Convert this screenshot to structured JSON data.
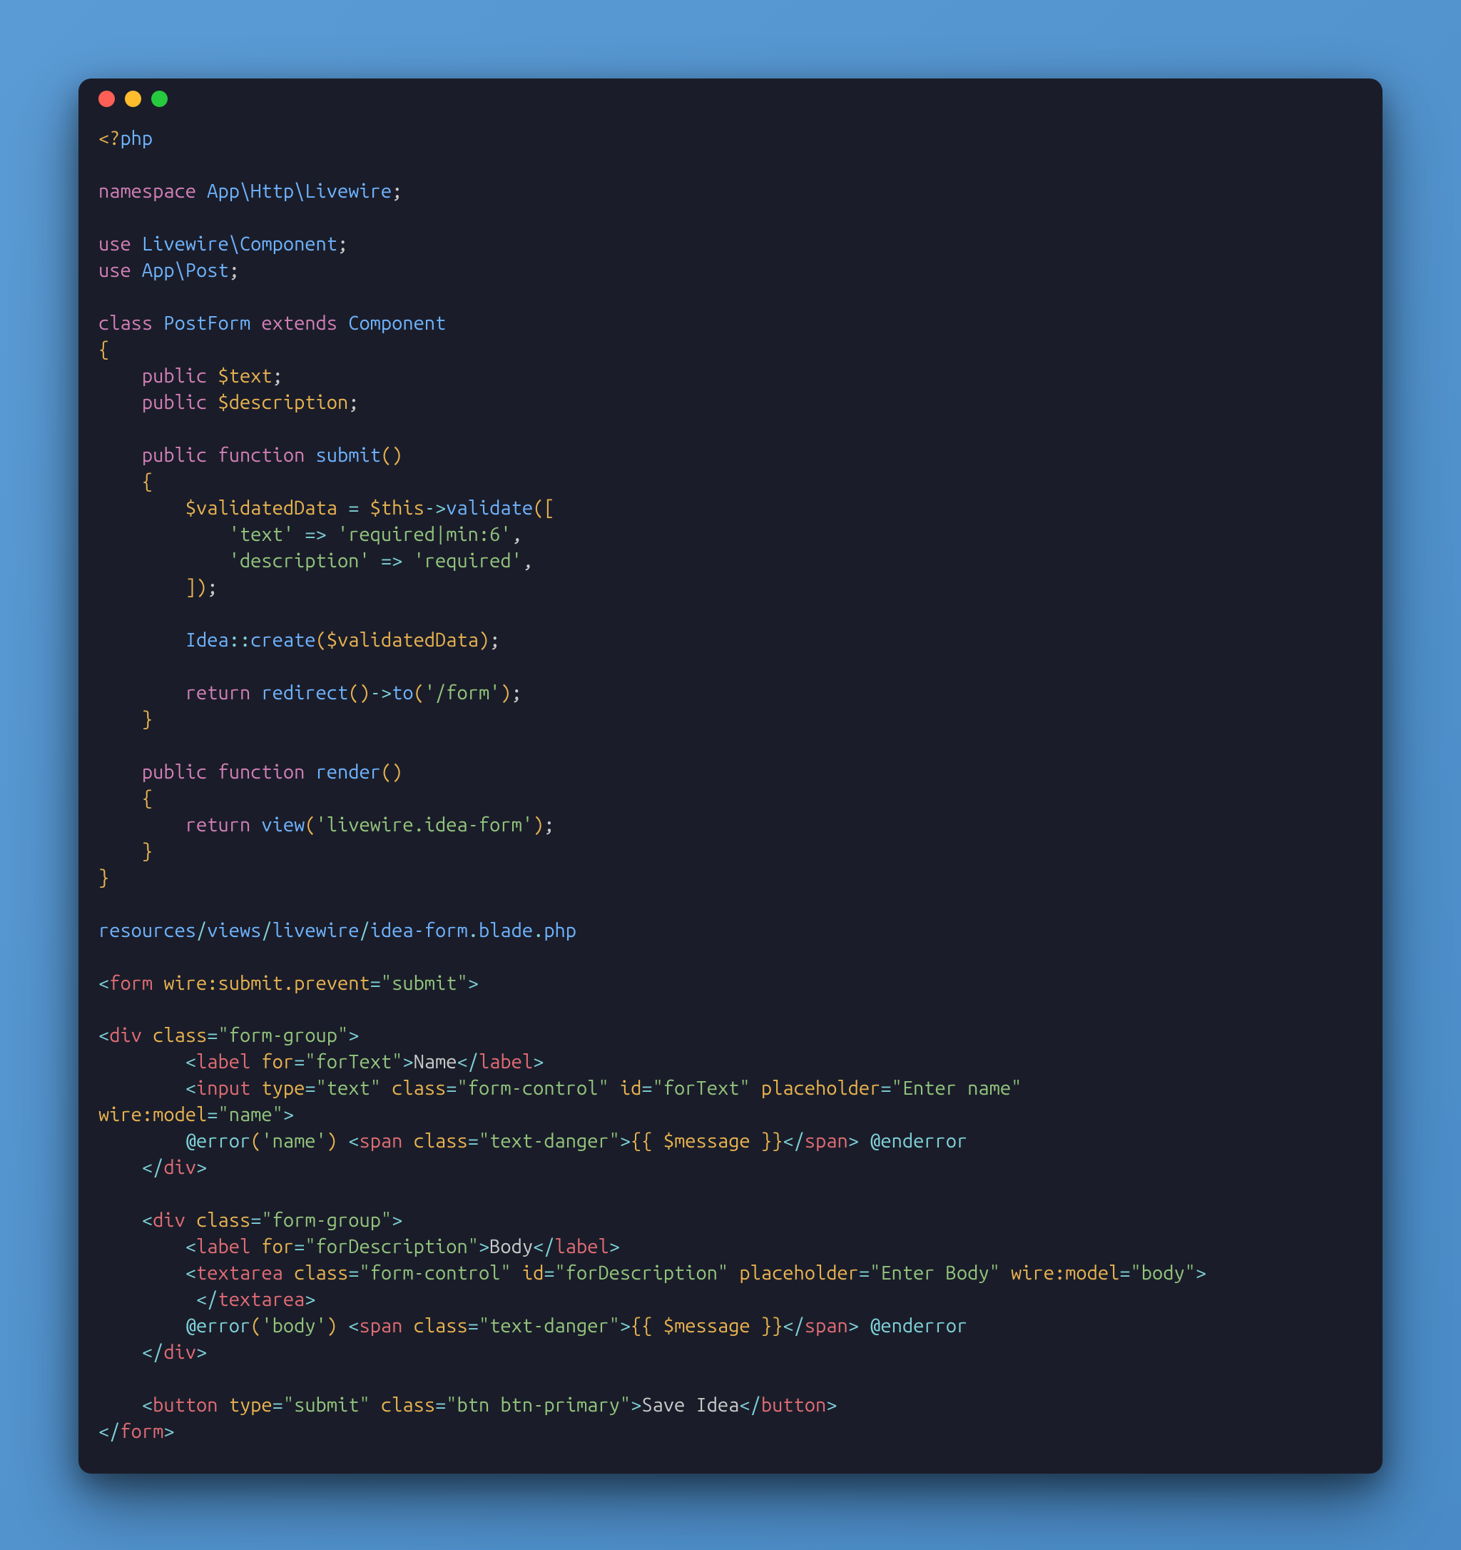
{
  "window": {
    "traffic_lights": [
      "close",
      "minimize",
      "zoom"
    ]
  },
  "code": {
    "php_open": "<?",
    "php_tag": "php",
    "kw_namespace": "namespace",
    "ns_path": "App\\Http\\Livewire",
    "kw_use1": "use",
    "use1_path": "Livewire\\Component",
    "kw_use2": "use",
    "use2_path": "App\\Post",
    "kw_class": "class",
    "class_name": "PostForm",
    "kw_extends": "extends",
    "extends_name": "Component",
    "kw_public1": "public",
    "var_text": "$text",
    "kw_public2": "public",
    "var_desc": "$description",
    "kw_public3": "public",
    "kw_function1": "function",
    "fn_submit": "submit",
    "var_validated": "$validatedData",
    "op_eq": "=",
    "var_this": "$this",
    "arrow": "->",
    "fn_validate": "validate",
    "rule_text_key": "'text'",
    "fat_arrow": "=>",
    "rule_text_val": "'required|min:6'",
    "rule_desc_key": "'description'",
    "rule_desc_val": "'required'",
    "idea": "Idea",
    "dbl_colon": "::",
    "fn_create": "create",
    "kw_return1": "return",
    "fn_redirect": "redirect",
    "fn_to": "to",
    "str_form": "'/form'",
    "kw_public4": "public",
    "kw_function2": "function",
    "fn_render": "render",
    "kw_return2": "return",
    "fn_view": "view",
    "str_view": "'livewire.idea-form'",
    "path_resources": "resources",
    "path_views": "views",
    "path_livewire": "livewire",
    "path_idea": "idea-form",
    "path_blade": "blade",
    "path_php": "php"
  },
  "blade": {
    "form": {
      "tag": "form",
      "attr_wire_submit": "wire:submit.prevent",
      "val_submit": "\"submit\""
    },
    "div": "div",
    "class_attr": "class",
    "form_group": "\"form-group\"",
    "label": "label",
    "for_attr": "for",
    "for_text": "\"forText\"",
    "label_name": "Name",
    "input": "input",
    "type_attr": "type",
    "type_text": "\"text\"",
    "form_control": "\"form-control\"",
    "id_attr": "id",
    "placeholder_attr": "placeholder",
    "placeholder_name": "\"Enter name\"",
    "wire_model": "wire:model",
    "model_name": "\"name\"",
    "error_dir": "@error",
    "error_name": "'name'",
    "span": "span",
    "text_danger": "\"text-danger\"",
    "mustache_open": "{{",
    "message_var": "$message",
    "mustache_close": "}}",
    "enderror_dir": "@enderror",
    "for_desc": "\"forDescription\"",
    "label_body": "Body",
    "textarea": "textarea",
    "placeholder_body": "\"Enter Body\"",
    "model_body": "\"body\"",
    "error_body": "'body'",
    "button": "button",
    "type_submit": "\"submit\"",
    "btn_primary": "\"btn btn-primary\"",
    "save_idea": "Save Idea"
  }
}
